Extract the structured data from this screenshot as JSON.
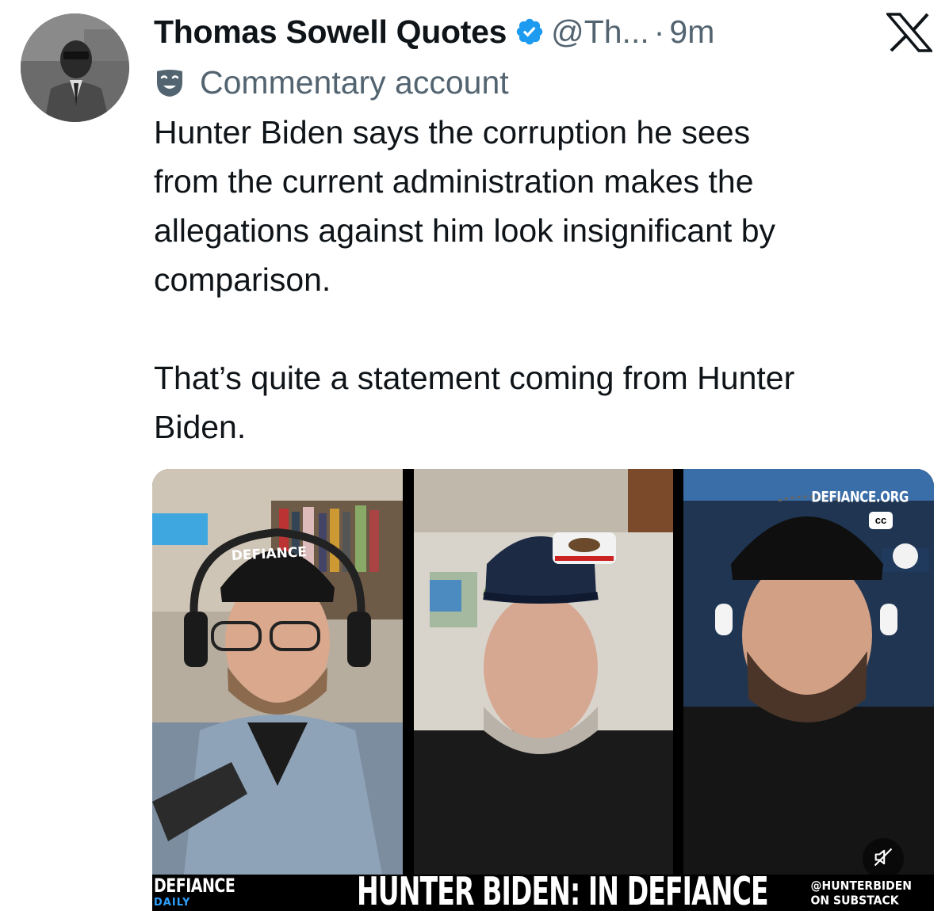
{
  "author": {
    "display_name": "Thomas Sowell Quotes",
    "handle": "@Th...",
    "separator": "·",
    "time": "9m",
    "label": "Commentary account"
  },
  "tweet": {
    "text": "Hunter Biden says the corruption he sees\nfrom the current administration makes the\nallegations against him look insignificant by\ncomparison.\n\nThat’s quite a statement coming from Hunter\nBiden."
  },
  "video": {
    "hat_text": "DEFIANCE",
    "corner_brand": "DEFIANCE.ORG",
    "cc_label": "cc",
    "lower_third": {
      "brand_line1": "DEFIANCE",
      "brand_line2": "DAILY",
      "title": "HUNTER BIDEN: IN DEFIANCE",
      "credit_line1": "@HUNTERBIDEN",
      "credit_line2": "ON SUBSTACK"
    }
  },
  "colors": {
    "verified_blue": "#1d9bf0",
    "secondary_text": "#536471",
    "primary_text": "#0f1419",
    "daily_blue": "#2fa0ff"
  },
  "icons": {
    "verified": "verified-badge-icon",
    "x_logo": "x-logo-icon",
    "commentary": "theater-mask-icon",
    "mute": "speaker-muted-icon"
  }
}
